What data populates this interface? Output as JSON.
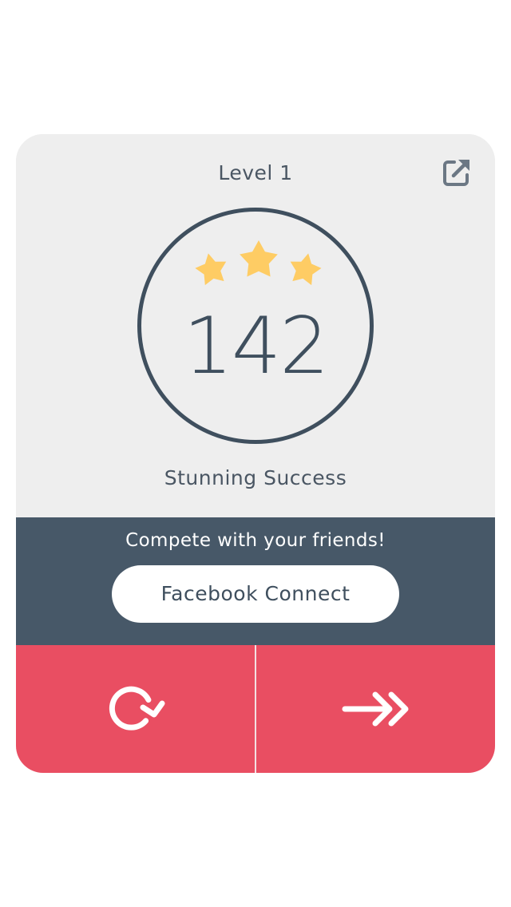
{
  "level": {
    "title": "Level 1",
    "stars_earned": 3,
    "stars_total": 3,
    "score": "142",
    "result": "Stunning Success"
  },
  "header": {
    "share_icon": "share-external-icon"
  },
  "social": {
    "prompt": "Compete with your friends!",
    "connect_label": "Facebook Connect"
  },
  "actions": {
    "retry_icon": "retry-icon",
    "next_icon": "next-double-arrow-icon"
  },
  "colors": {
    "card_background": "#eeeeee",
    "ring": "#3f4f5e",
    "star": "#fecc64",
    "social_band": "#475868",
    "action_band": "#e94e62",
    "share_icon": "#6b7784"
  }
}
